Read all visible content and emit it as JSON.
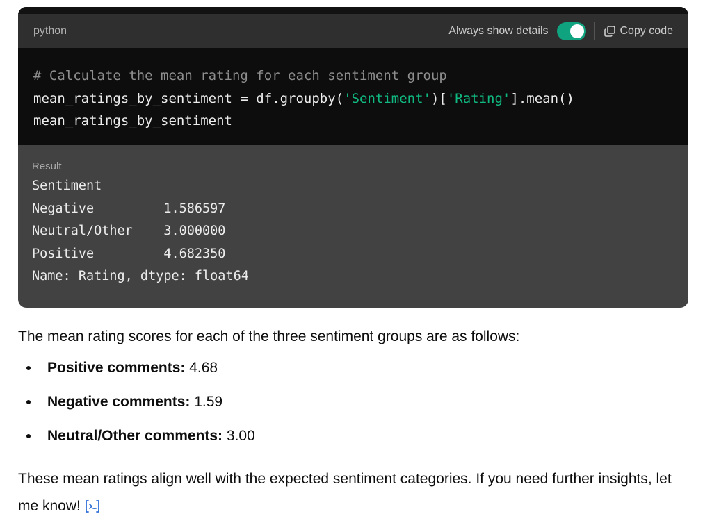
{
  "code_block": {
    "language": "python",
    "toggle_label": "Always show details",
    "toggle_on": true,
    "copy_label": "Copy code",
    "code": {
      "line1": "# Calculate the mean rating for each sentiment group",
      "line2_pre": "mean_ratings_by_sentiment = df.groupby(",
      "line2_str1": "'Sentiment'",
      "line2_mid": ")[",
      "line2_str2": "'Rating'",
      "line2_post": "].mean()",
      "line3": "mean_ratings_by_sentiment"
    },
    "result": {
      "label": "Result",
      "output": "Sentiment\nNegative         1.586597\nNeutral/Other    3.000000\nPositive         4.682350\nName: Rating, dtype: float64"
    }
  },
  "response": {
    "intro": "The mean rating scores for each of the three sentiment groups are as follows:",
    "items": [
      {
        "label": "Positive comments:",
        "value": " 4.68"
      },
      {
        "label": "Negative comments:",
        "value": " 1.59"
      },
      {
        "label": "Neutral/Other comments:",
        "value": " 3.00"
      }
    ],
    "closing": "These mean ratings align well with the expected sentiment categories. If you need further insights, let me know!"
  },
  "colors": {
    "accent": "#10a37f",
    "link_icon": "#2f6fd6"
  },
  "icons": {
    "copy": "copy-icon",
    "code_interpreter": "code-interpreter-icon"
  }
}
